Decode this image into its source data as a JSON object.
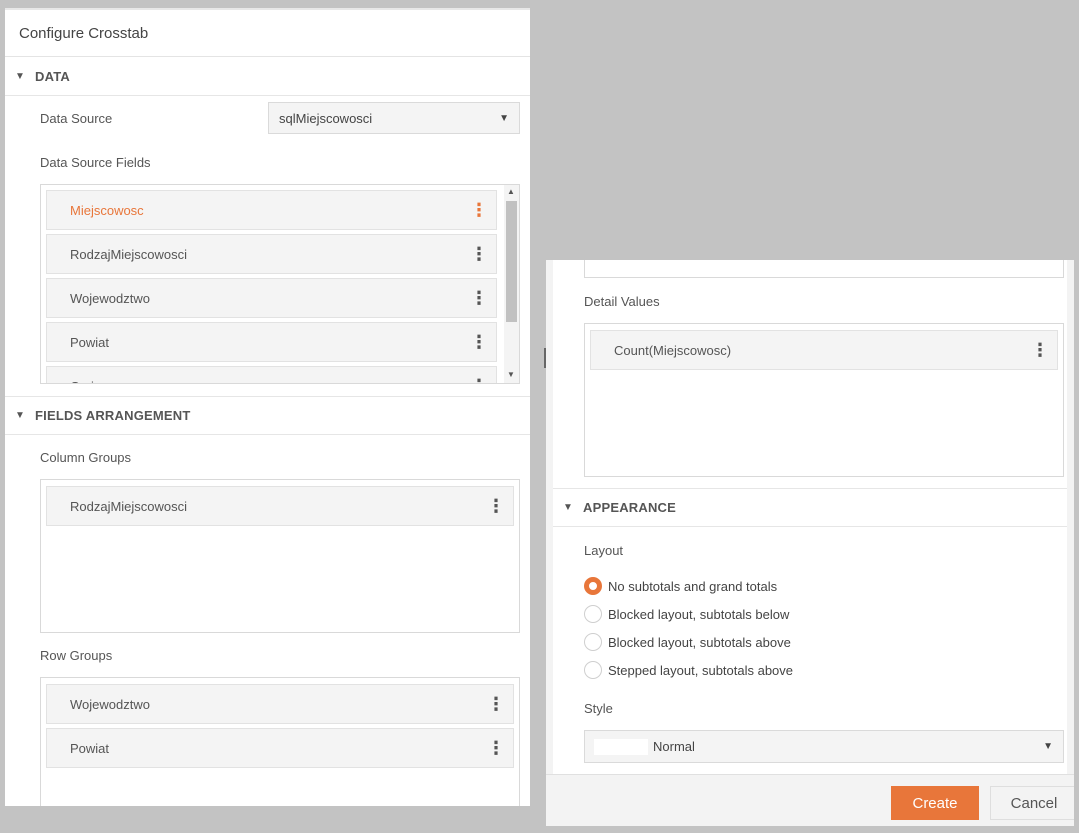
{
  "dialog": {
    "title": "Configure Crosstab"
  },
  "data_section": {
    "header": "DATA",
    "data_source_label": "Data Source",
    "data_source_value": "sqlMiejscowosci",
    "fields_label": "Data Source Fields",
    "fields": [
      "Miejscowosc",
      "RodzajMiejscowosci",
      "Wojewodztwo",
      "Powiat",
      "Gmina"
    ],
    "active_field_index": 0
  },
  "arrangement": {
    "header": "FIELDS ARRANGEMENT",
    "column_groups_label": "Column Groups",
    "column_groups": [
      "RodzajMiejscowosci"
    ],
    "row_groups_label": "Row Groups",
    "row_groups": [
      "Wojewodztwo",
      "Powiat"
    ],
    "detail_values_label": "Detail Values",
    "detail_values": [
      "Count(Miejscowosc)"
    ]
  },
  "appearance": {
    "header": "APPEARANCE",
    "layout_label": "Layout",
    "layout_options": [
      "No subtotals and grand totals",
      "Blocked layout, subtotals below",
      "Blocked layout, subtotals above",
      "Stepped layout, subtotals above"
    ],
    "selected_layout_index": 0,
    "style_label": "Style",
    "style_value": "Normal"
  },
  "buttons": {
    "create": "Create",
    "cancel": "Cancel"
  },
  "colors": {
    "accent": "#e8763a"
  }
}
